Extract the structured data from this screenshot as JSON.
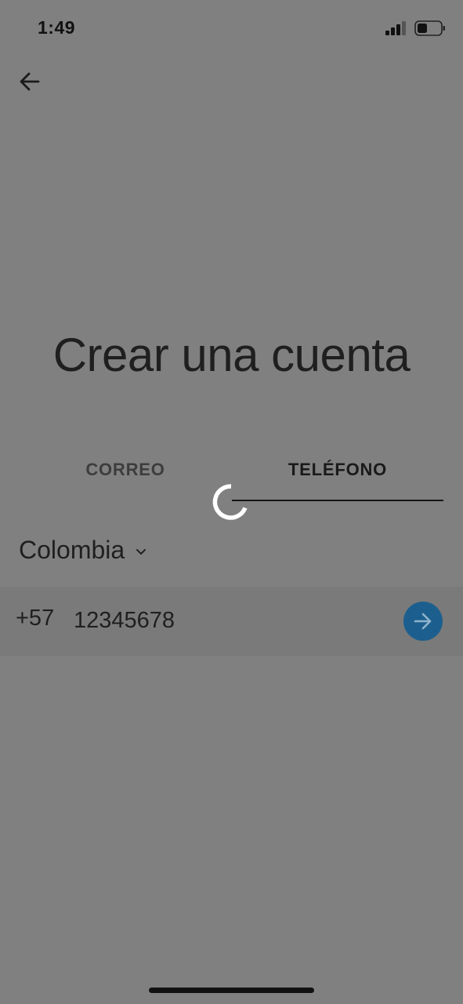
{
  "status_bar": {
    "time": "1:49"
  },
  "header": {
    "back_icon": "arrow-left-icon"
  },
  "title": "Crear una cuenta",
  "tabs": [
    {
      "label": "CORREO",
      "active": false
    },
    {
      "label": "TELÉFONO",
      "active": true
    }
  ],
  "loading": true,
  "country": {
    "name": "Colombia",
    "dropdown_icon": "chevron-down-icon"
  },
  "phone": {
    "country_code": "+57",
    "value": "12345678",
    "submit_icon": "arrow-right-icon"
  },
  "colors": {
    "overlay_background": "#808080",
    "accent": "#1c5f8e",
    "text": "#1f1f1f"
  }
}
